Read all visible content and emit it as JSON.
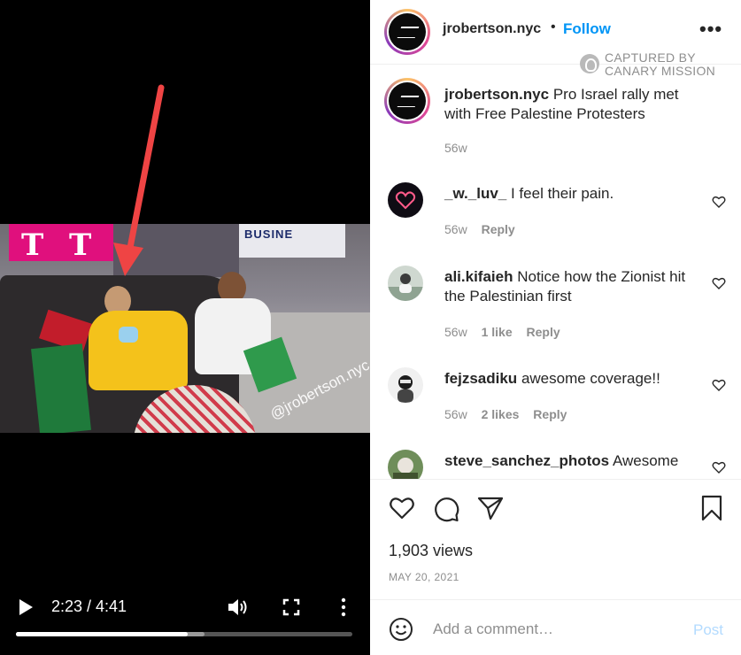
{
  "video": {
    "overlay_watermark": "@jrobertson.nyc",
    "sign_letters": [
      "T",
      "T"
    ],
    "street_sign_text": "BUSINE",
    "controls": {
      "time_display": "2:23 / 4:41",
      "progress_fraction": 0.51,
      "buffered_fraction": 0.56
    }
  },
  "header": {
    "username": "jrobertson.nyc",
    "separator": "•",
    "follow_label": "Follow",
    "more_label": "•••"
  },
  "watermark": {
    "line1": "CAPTURED BY",
    "line2": "CANARY MISSION"
  },
  "caption": {
    "username": "jrobertson.nyc",
    "text": "Pro Israel rally met with Free Palestine Protesters",
    "age": "56w"
  },
  "comments": [
    {
      "username": "_w._luv_",
      "text": "I feel their pain.",
      "age": "56w",
      "likes": "",
      "reply": "Reply"
    },
    {
      "username": "ali.kifaieh",
      "text": "Notice how the Zionist hit the Palestinian first",
      "age": "56w",
      "likes": "1 like",
      "reply": "Reply"
    },
    {
      "username": "fejzsadiku",
      "text": "awesome coverage!!",
      "age": "56w",
      "likes": "2 likes",
      "reply": "Reply"
    },
    {
      "username": "steve_sanchez_photos",
      "text": "Awesome",
      "age": "",
      "likes": "",
      "reply": ""
    }
  ],
  "post": {
    "views": "1,903 views",
    "date": "MAY 20, 2021"
  },
  "composer": {
    "placeholder": "Add a comment…",
    "post_label": "Post"
  },
  "icons": {
    "like": "heart-icon",
    "comment": "speech-bubble-icon",
    "share": "paper-plane-icon",
    "save": "bookmark-icon",
    "emoji": "smiley-icon",
    "play": "play-icon",
    "volume": "volume-icon",
    "fullscreen": "fullscreen-icon",
    "video_more": "vertical-dots-icon"
  },
  "colors": {
    "accent": "#0095f6",
    "annotation_arrow": "#ef4444",
    "post_disabled": "#b3dbff"
  }
}
